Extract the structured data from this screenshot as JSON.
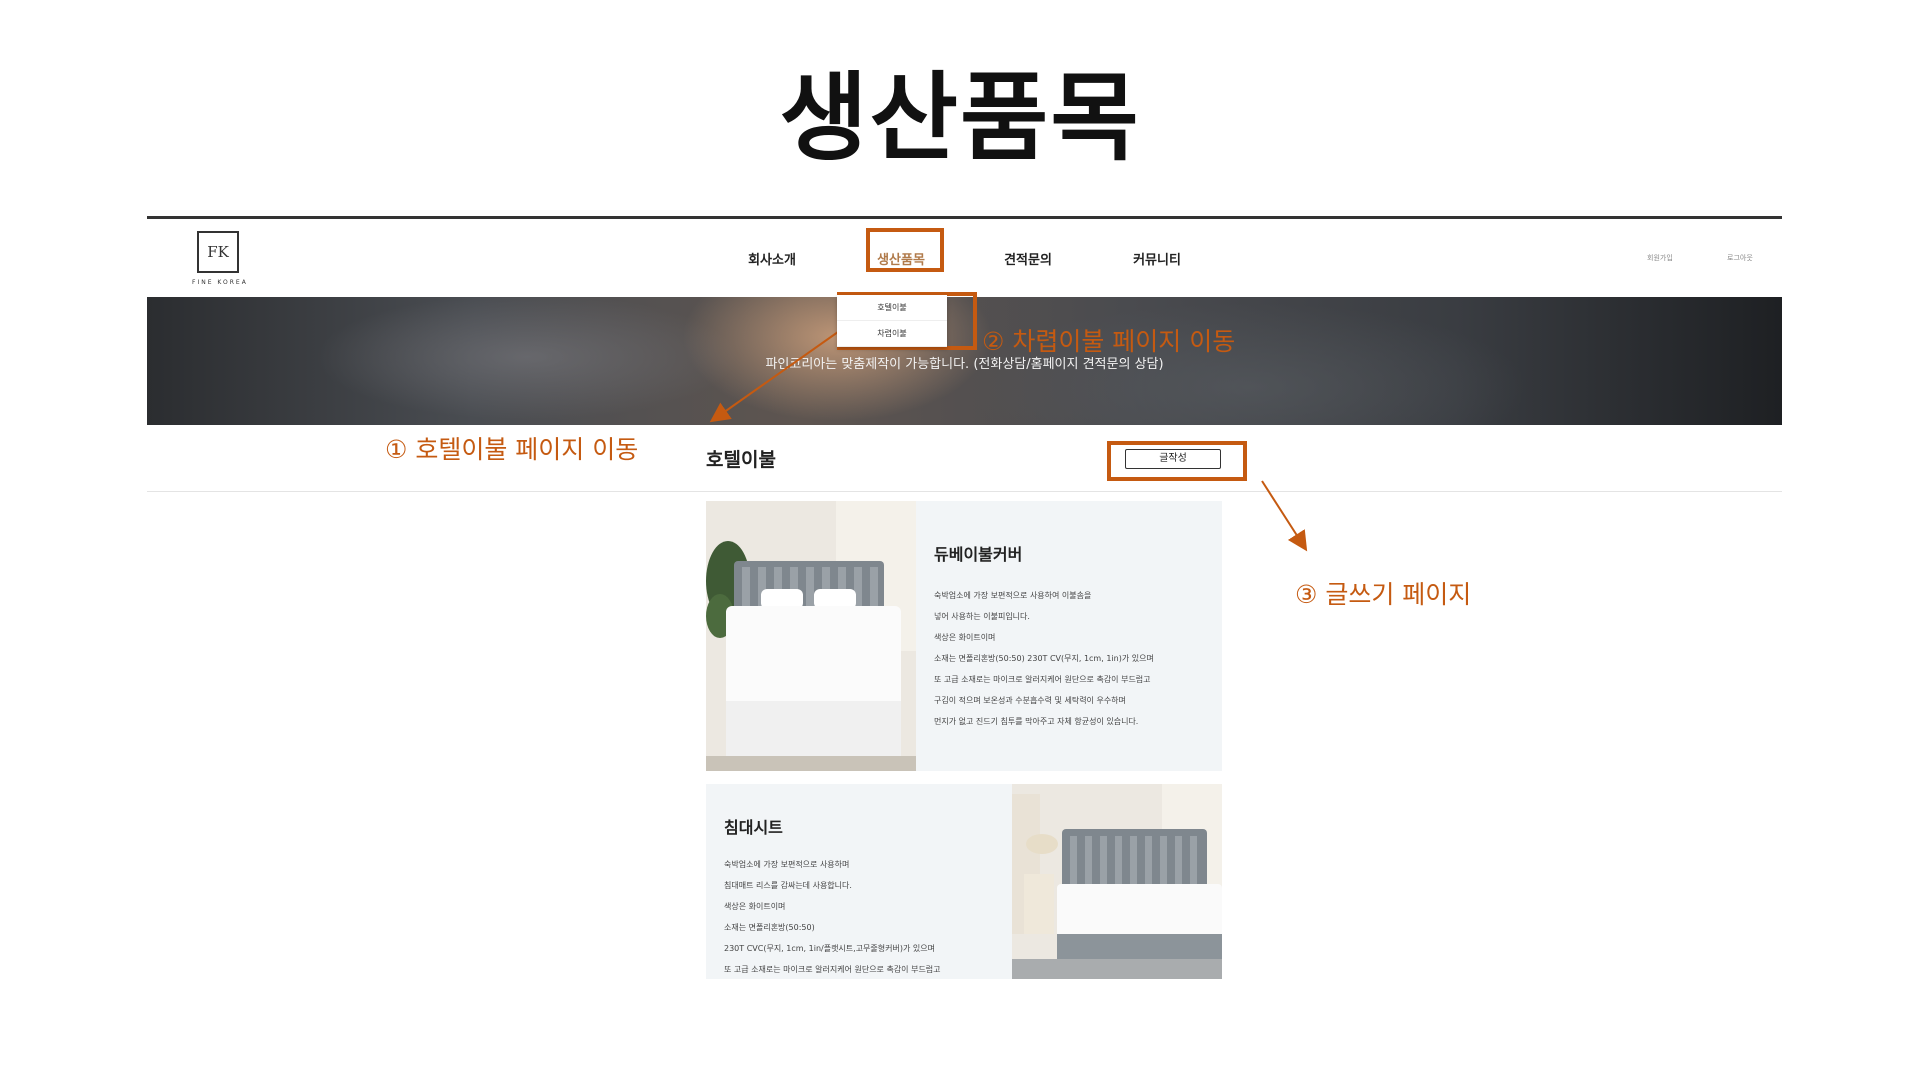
{
  "slide": {
    "title": "생산품목"
  },
  "logo": {
    "mark": "FK",
    "text": "FINE KOREA"
  },
  "nav": {
    "items": [
      "회사소개",
      "생산품목",
      "견적문의",
      "커뮤니티"
    ],
    "active": "생산품목"
  },
  "utility": {
    "signup": "회원가입",
    "login": "로그아웃"
  },
  "dropdown": {
    "items": [
      "호텔이불",
      "차렵이불"
    ]
  },
  "hero": {
    "text": "파인코리아는 맞춤제작이 가능합니다. (전화상담/홈페이지 견적문의 상담)"
  },
  "section": {
    "title": "호텔이불",
    "write_button": "글작성"
  },
  "cards": [
    {
      "title": "듀베이불커버",
      "lines": [
        "숙박업소에 가장 보편적으로 사용하여 이불솜을",
        "넣어 사용하는 이불피입니다.",
        "색상은 화이트이며",
        "소재는 면폴리혼방(50:50) 230T CV(무지, 1cm, 1in)가 있으며",
        "또 고급 소재로는 마이크로 알러지케어 원단으로 촉감이 부드럽고",
        "구김이 적으며 보온성과 수분흡수력 및 세탁력이 우수하며",
        "먼지가 없고 진드기 침투를 막아주고 자체 항균성이 있습니다."
      ]
    },
    {
      "title": "침대시트",
      "lines": [
        "숙박업소에 가장 보편적으로 사용하며",
        "침대매트 리스를 감싸는데 사용합니다.",
        "색상은 화이트이며",
        "소재는 면폴리혼방(50:50)",
        "230T CVC(무지, 1cm, 1in/플랫시트,고무줄형커버)가 있으며",
        "또 고급 소재로는 마이크로 알러지케어 원단으로 촉감이 부드럽고"
      ]
    }
  ],
  "annotations": {
    "a1": "① 호텔이불 페이지 이동",
    "a2": "② 차렵이불 페이지 이동",
    "a3": "③ 글쓰기 페이지",
    "color": "#c55a11"
  }
}
